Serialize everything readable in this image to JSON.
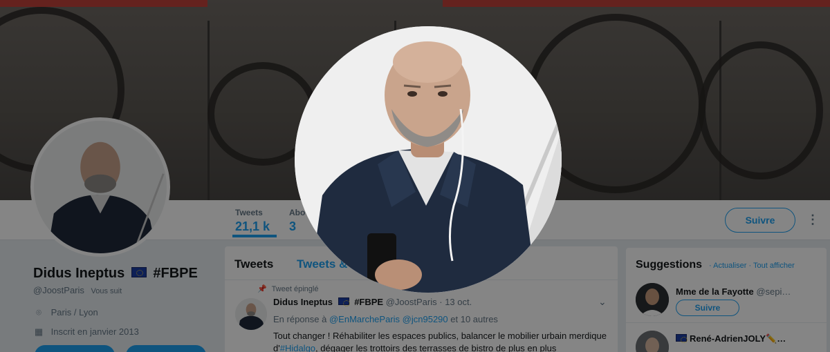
{
  "profile": {
    "display_name": "Didus Ineptus",
    "hashtag": "#FBPE",
    "handle": "@JoostParis",
    "follows_you": "Vous suit",
    "location": "Paris / Lyon",
    "joined": "Inscrit en janvier 2013"
  },
  "nav": {
    "tweets_label": "Tweets",
    "tweets_count": "21,1 k",
    "abonnements_label": "Abo",
    "abonnements_count": "3",
    "follow_label": "Suivre",
    "more_label": "⋮"
  },
  "timeline": {
    "tab_tweets": "Tweets",
    "tab_replies": "Tweets &",
    "pinned_label": "Tweet épinglé",
    "tweet": {
      "author": "Didus Ineptus",
      "hashtag": "#FBPE",
      "handle": "@JoostParis",
      "date": "· 13 oct.",
      "reply_prefix": "En réponse à",
      "reply_to_1": "@EnMarcheParis",
      "reply_to_2": "@jcn95290",
      "reply_suffix": "et 10 autres",
      "text_1": "Tout changer ! Réhabiliter les espaces publics, balancer le mobilier urbain merdique",
      "text_2_prefix": "d'",
      "text_2_link": "#Hidalgo",
      "text_2_suffix": ", dégager les trottoirs des terrasses de bistro de plus en plus"
    }
  },
  "suggestions": {
    "title": "Suggestions",
    "refresh": "· Actualiser",
    "show_all": "· Tout afficher",
    "items": [
      {
        "name": "Mme de la Fayotte",
        "handle": "@sepi…",
        "follow_label": "Suivre"
      },
      {
        "name": "René-AdrienJOLY✏️…",
        "handle": ""
      }
    ]
  },
  "icons": [
    "location-pin-icon",
    "calendar-icon",
    "pin-icon",
    "chevron-down-icon",
    "eu-flag-icon"
  ],
  "colors": {
    "accent": "#1da1f2",
    "overlay": "rgba(0,0,0,0.48)"
  }
}
